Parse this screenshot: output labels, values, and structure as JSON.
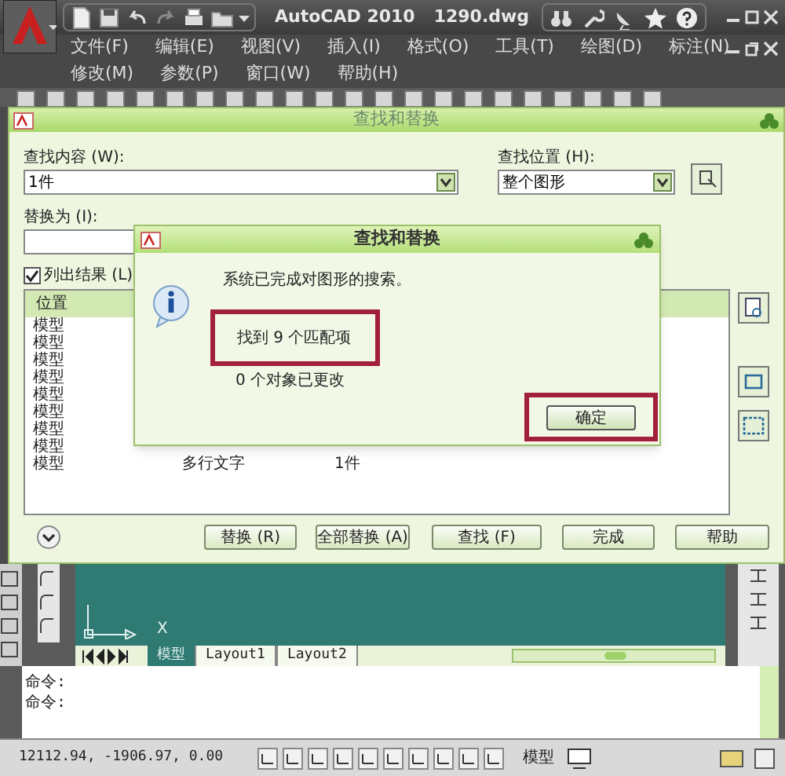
{
  "app": {
    "title": "AutoCAD 2010",
    "file": "1290.dwg"
  },
  "menu_rows": [
    {
      "items": [
        "文件(F)",
        "编辑(E)",
        "视图(V)",
        "插入(I)",
        "格式(O)",
        "工具(T)",
        "绘图(D)",
        "标注(N)"
      ]
    },
    {
      "items": [
        "修改(M)",
        "参数(P)",
        "窗口(W)",
        "帮助(H)"
      ]
    }
  ],
  "dialog": {
    "title": "查找和替换",
    "find_label": "查找内容 (W):",
    "find_value": "1件",
    "location_label": "查找位置 (H):",
    "location_value": "整个图形",
    "replace_label": "替换为 (I):",
    "list_results": {
      "label": "列出结果 (L)",
      "checked": true
    },
    "results": {
      "header": "位置",
      "rows": [
        {
          "cells": [
            "模型"
          ]
        },
        {
          "cells": [
            "模型"
          ]
        },
        {
          "cells": [
            "模型"
          ]
        },
        {
          "cells": [
            "模型"
          ]
        },
        {
          "cells": [
            "模型"
          ]
        },
        {
          "cells": [
            "模型"
          ]
        },
        {
          "cells": [
            "模型"
          ]
        },
        {
          "cells": [
            "模型"
          ]
        },
        {
          "cells": [
            "模型",
            "多行文字",
            "1件"
          ]
        }
      ]
    },
    "buttons": [
      "替换 (R)",
      "全部替换 (A)",
      "查找 (F)",
      "完成",
      "帮助"
    ]
  },
  "message_box": {
    "title": "查找和替换",
    "message": "系统已完成对图形的搜索。",
    "found": "找到 9 个匹配项",
    "changed": "0 个对象已更改",
    "ok": "确定"
  },
  "drawing": {
    "axis_label": "X"
  },
  "layout_tabs": [
    {
      "label": "模型",
      "selected": true
    },
    {
      "label": "Layout1",
      "selected": false
    },
    {
      "label": "Layout2",
      "selected": false
    }
  ],
  "command_lines": [
    "命令:",
    "命令:"
  ],
  "status_bar": {
    "coordinates": "12112.94, -1906.97, 0.00",
    "space": "模型"
  }
}
